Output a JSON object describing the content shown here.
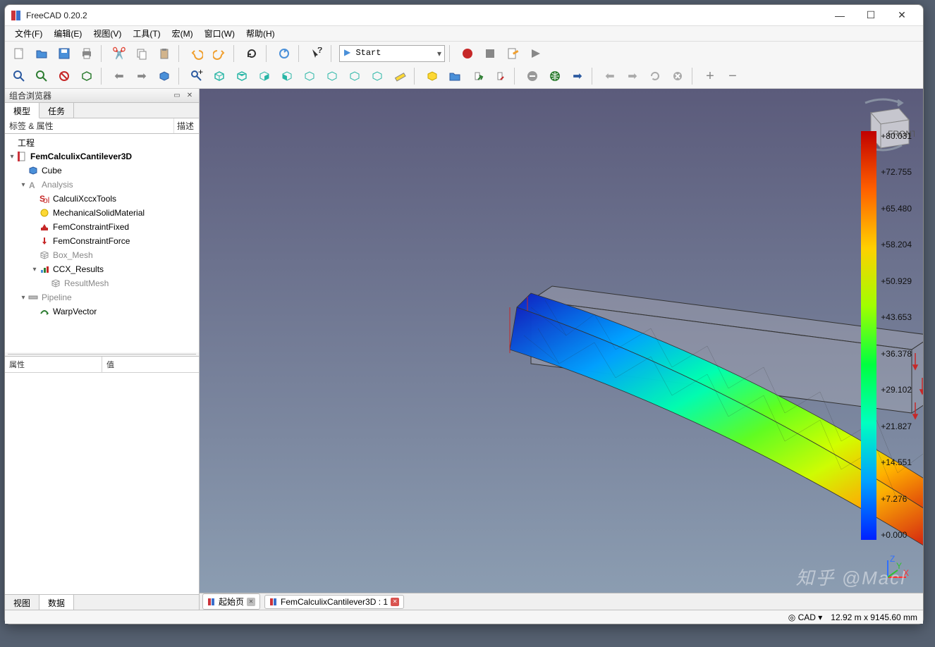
{
  "window": {
    "title": "FreeCAD 0.20.2"
  },
  "menus": [
    "文件(F)",
    "编辑(E)",
    "视图(V)",
    "工具(T)",
    "宏(M)",
    "窗口(W)",
    "帮助(H)"
  ],
  "workbench_selector": "Start",
  "sidebar": {
    "panel_title": "组合浏览器",
    "tabs": {
      "model": "模型",
      "tasks": "任务"
    },
    "header": {
      "labels": "标签 & 属性",
      "desc": "描述"
    },
    "tree_root": "工程",
    "tree": [
      {
        "depth": 0,
        "tw": "▾",
        "icon": "doc",
        "label": "FemCalculixCantilever3D",
        "bold": true
      },
      {
        "depth": 1,
        "tw": "",
        "icon": "cube-blue",
        "label": "Cube"
      },
      {
        "depth": 1,
        "tw": "▾",
        "icon": "analysis",
        "label": "Analysis",
        "gray": true
      },
      {
        "depth": 2,
        "tw": "",
        "icon": "solver",
        "label": "CalculiXccxTools"
      },
      {
        "depth": 2,
        "tw": "",
        "icon": "material",
        "label": "MechanicalSolidMaterial"
      },
      {
        "depth": 2,
        "tw": "",
        "icon": "constraint-fixed",
        "label": "FemConstraintFixed"
      },
      {
        "depth": 2,
        "tw": "",
        "icon": "constraint-force",
        "label": "FemConstraintForce"
      },
      {
        "depth": 2,
        "tw": "",
        "icon": "mesh",
        "label": "Box_Mesh",
        "gray": true
      },
      {
        "depth": 2,
        "tw": "▾",
        "icon": "results",
        "label": "CCX_Results"
      },
      {
        "depth": 3,
        "tw": "",
        "icon": "mesh",
        "label": "ResultMesh",
        "gray": true
      },
      {
        "depth": 1,
        "tw": "▾",
        "icon": "pipeline",
        "label": "Pipeline",
        "gray": true
      },
      {
        "depth": 2,
        "tw": "",
        "icon": "warp",
        "label": "WarpVector"
      }
    ],
    "props": {
      "name": "属性",
      "value": "值"
    },
    "bottom_tabs": {
      "view": "视图",
      "data": "数据"
    }
  },
  "doc_tabs": [
    {
      "label": "起始页",
      "closable_gray": true
    },
    {
      "label": "FemCalculixCantilever3D : 1",
      "closable_red": true
    }
  ],
  "statusbar": {
    "mode": "CAD",
    "dims": "12.92 m x 9145.60 mm"
  },
  "chart_data": {
    "type": "colorbar",
    "title": "",
    "labels": [
      "+80.031",
      "+72.755",
      "+65.480",
      "+58.204",
      "+50.929",
      "+43.653",
      "+36.378",
      "+29.102",
      "+21.827",
      "+14.551",
      "+7.276",
      "+0.000"
    ],
    "range": [
      0.0,
      80.031
    ]
  },
  "nav_cube_face": "FRONT",
  "watermark": "知乎 @Macl"
}
